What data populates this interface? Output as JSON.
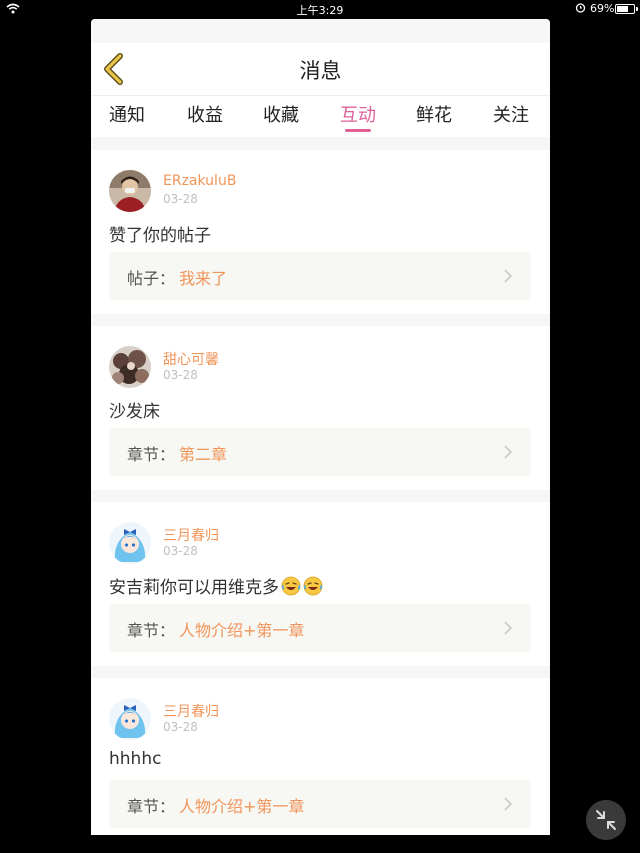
{
  "status_bar": {
    "time": "上午3:29",
    "battery": "69%",
    "battery_level": 0.69
  },
  "header": {
    "title": "消息"
  },
  "tabs": [
    {
      "label": "通知",
      "active": false
    },
    {
      "label": "收益",
      "active": false
    },
    {
      "label": "收藏",
      "active": false
    },
    {
      "label": "互动",
      "active": true
    },
    {
      "label": "鲜花",
      "active": false
    },
    {
      "label": "关注",
      "active": false
    }
  ],
  "messages": [
    {
      "user": "ERzakuluB",
      "date": "03-28",
      "content": "赞了你的帖子",
      "emoji_count": 0,
      "ref_label": "帖子：",
      "ref_value": "我来了",
      "avatar": "person-photo"
    },
    {
      "user": "甜心可馨",
      "date": "03-28",
      "content": "沙发床",
      "emoji_count": 0,
      "ref_label": "章节：",
      "ref_value": "第二章",
      "avatar": "group-photo"
    },
    {
      "user": "三月春归",
      "date": "03-28",
      "content": "安吉莉你可以用维克多",
      "emoji_count": 2,
      "ref_label": "章节：",
      "ref_value": "人物介绍+第一章",
      "avatar": "anime-girl"
    },
    {
      "user": "三月春归",
      "date": "03-28",
      "content": "hhhhc",
      "emoji_count": 0,
      "ref_label": "章节：",
      "ref_value": "人物介绍+第一章",
      "avatar": "anime-girl"
    }
  ],
  "colors": {
    "accent": "#e0609a",
    "username": "#f0955a",
    "reference": "#f0955a",
    "back_arrow": "#d4b13a"
  },
  "icons": {
    "back": "chevron-left-icon",
    "chevron": "chevron-right-icon",
    "shrink": "shrink-arrows-icon",
    "emoji": "laughing-emoji-icon"
  }
}
